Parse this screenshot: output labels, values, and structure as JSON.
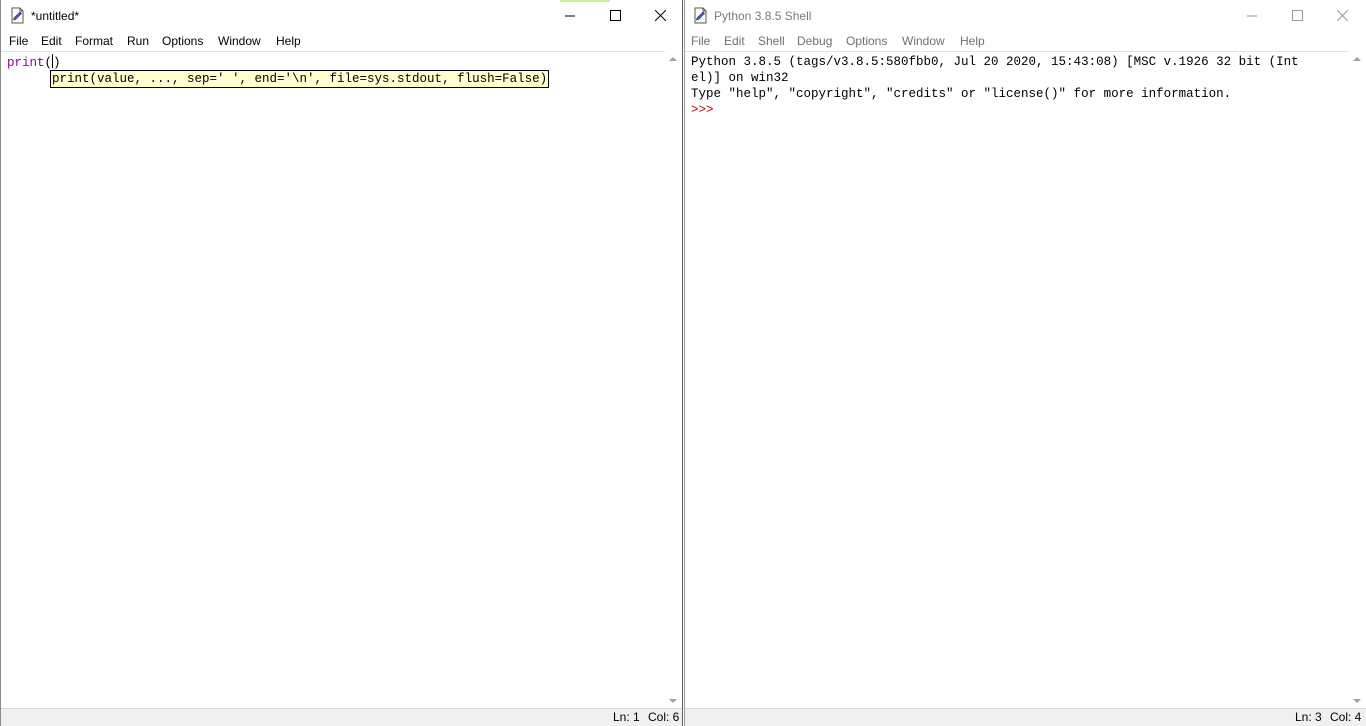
{
  "editor": {
    "title": "*untitled*",
    "menu": [
      "File",
      "Edit",
      "Format",
      "Run",
      "Options",
      "Window",
      "Help"
    ],
    "code_keyword": "print",
    "code_rest": "(",
    "code_after_cursor": ")",
    "calltip": "print(value, ..., sep=' ', end='\\n', file=sys.stdout, flush=False)",
    "status": {
      "line": "Ln: 1",
      "col": "Col: 6"
    }
  },
  "shell": {
    "title": "Python 3.8.5 Shell",
    "menu": [
      "File",
      "Edit",
      "Shell",
      "Debug",
      "Options",
      "Window",
      "Help"
    ],
    "banner_line1": "Python 3.8.5 (tags/v3.8.5:580fbb0, Jul 20 2020, 15:43:08) [MSC v.1926 32 bit (Int",
    "banner_line2": "el)] on win32",
    "banner_line3": "Type \"help\", \"copyright\", \"credits\" or \"license()\" for more information.",
    "prompt": ">>> ",
    "status": {
      "line": "Ln: 3",
      "col": "Col: 4"
    }
  },
  "colors": {
    "keyword": "#900090",
    "prompt": "#c00000",
    "calltip_bg": "#ffffd0"
  },
  "icons": {
    "app": "idle-document-icon",
    "minimize": "minimize-icon",
    "maximize": "maximize-icon",
    "close": "close-icon"
  }
}
